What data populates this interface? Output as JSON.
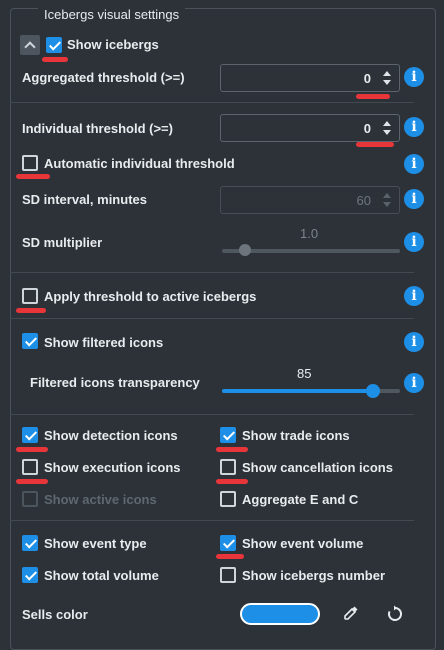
{
  "group_title": "Icebergs visual settings",
  "show_icebergs": {
    "label": "Show icebergs",
    "checked": true
  },
  "aggregated_threshold": {
    "label": "Aggregated threshold (>=)",
    "value": "0"
  },
  "individual_threshold": {
    "label": "Individual threshold (>=)",
    "value": "0"
  },
  "automatic_individual_threshold": {
    "label": "Automatic individual threshold",
    "checked": false
  },
  "sd_interval": {
    "label": "SD interval, minutes",
    "value": "60",
    "disabled": true
  },
  "sd_multiplier": {
    "label": "SD multiplier",
    "value": "1.0",
    "disabled": true
  },
  "apply_threshold_active": {
    "label": "Apply threshold to active icebergs",
    "checked": false
  },
  "show_filtered_icons": {
    "label": "Show filtered icons",
    "checked": true
  },
  "filtered_icons_transparency": {
    "label": "Filtered icons transparency",
    "value": "85",
    "fraction": 0.85
  },
  "show_detection_icons": {
    "label": "Show detection icons",
    "checked": true
  },
  "show_trade_icons": {
    "label": "Show trade icons",
    "checked": true
  },
  "show_execution_icons": {
    "label": "Show execution icons",
    "checked": false
  },
  "show_cancellation_icons": {
    "label": "Show cancellation icons",
    "checked": false
  },
  "show_active_icons": {
    "label": "Show active icons",
    "checked": false,
    "disabled": true
  },
  "aggregate_e_and_c": {
    "label": "Aggregate E and C",
    "checked": false
  },
  "show_event_type": {
    "label": "Show event type",
    "checked": true
  },
  "show_event_volume": {
    "label": "Show event volume",
    "checked": true
  },
  "show_total_volume": {
    "label": "Show total volume",
    "checked": true
  },
  "show_icebergs_number": {
    "label": "Show icebergs number",
    "checked": false
  },
  "sells_color": {
    "label": "Sells color",
    "color": "#1e8fe6"
  },
  "info_icon_glyph": "i",
  "colors": {
    "accent": "#1e8fe6",
    "highlight": "#e8353a",
    "background": "#2c3238"
  }
}
